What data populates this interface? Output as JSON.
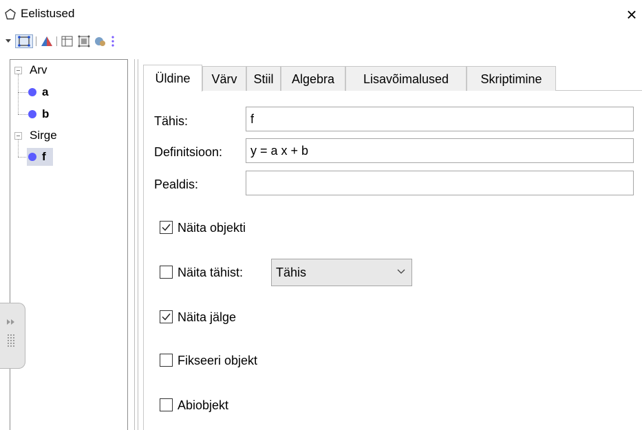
{
  "window": {
    "title": "Eelistused",
    "close_glyph": "×"
  },
  "toolbar": {
    "icons": [
      "dropdown-arrow-icon",
      "point-icon",
      "triangle-graphics-icon",
      "spreadsheet-icon",
      "layout-icon",
      "defaults-icon",
      "more-icon"
    ]
  },
  "tree": {
    "groups": [
      {
        "label": "Arv",
        "items": [
          "a",
          "b"
        ]
      },
      {
        "label": "Sirge",
        "items": [
          "f"
        ]
      }
    ]
  },
  "tabs": [
    "Üldine",
    "Värv",
    "Stiil",
    "Algebra",
    "Lisavõimalused",
    "Skriptimine"
  ],
  "active_tab": "Üldine",
  "form": {
    "name_label": "Tähis:",
    "name_value": "f",
    "definition_label": "Definitsioon:",
    "definition_value": "y = a x + b",
    "caption_label": "Pealdis:",
    "caption_value": "",
    "show_object": {
      "label": "Näita objekti",
      "checked": true
    },
    "show_label": {
      "label": "Näita tähist:",
      "checked": false
    },
    "label_mode": {
      "selected": "Tähis"
    },
    "show_trace": {
      "label": "Näita jälge",
      "checked": true
    },
    "fix_object": {
      "label": "Fikseeri objekt",
      "checked": false
    },
    "auxiliary": {
      "label": "Abiobjekt",
      "checked": false
    }
  },
  "colors": {
    "accent_dot": "#5b5bff",
    "selection": "#d7dbe8"
  }
}
